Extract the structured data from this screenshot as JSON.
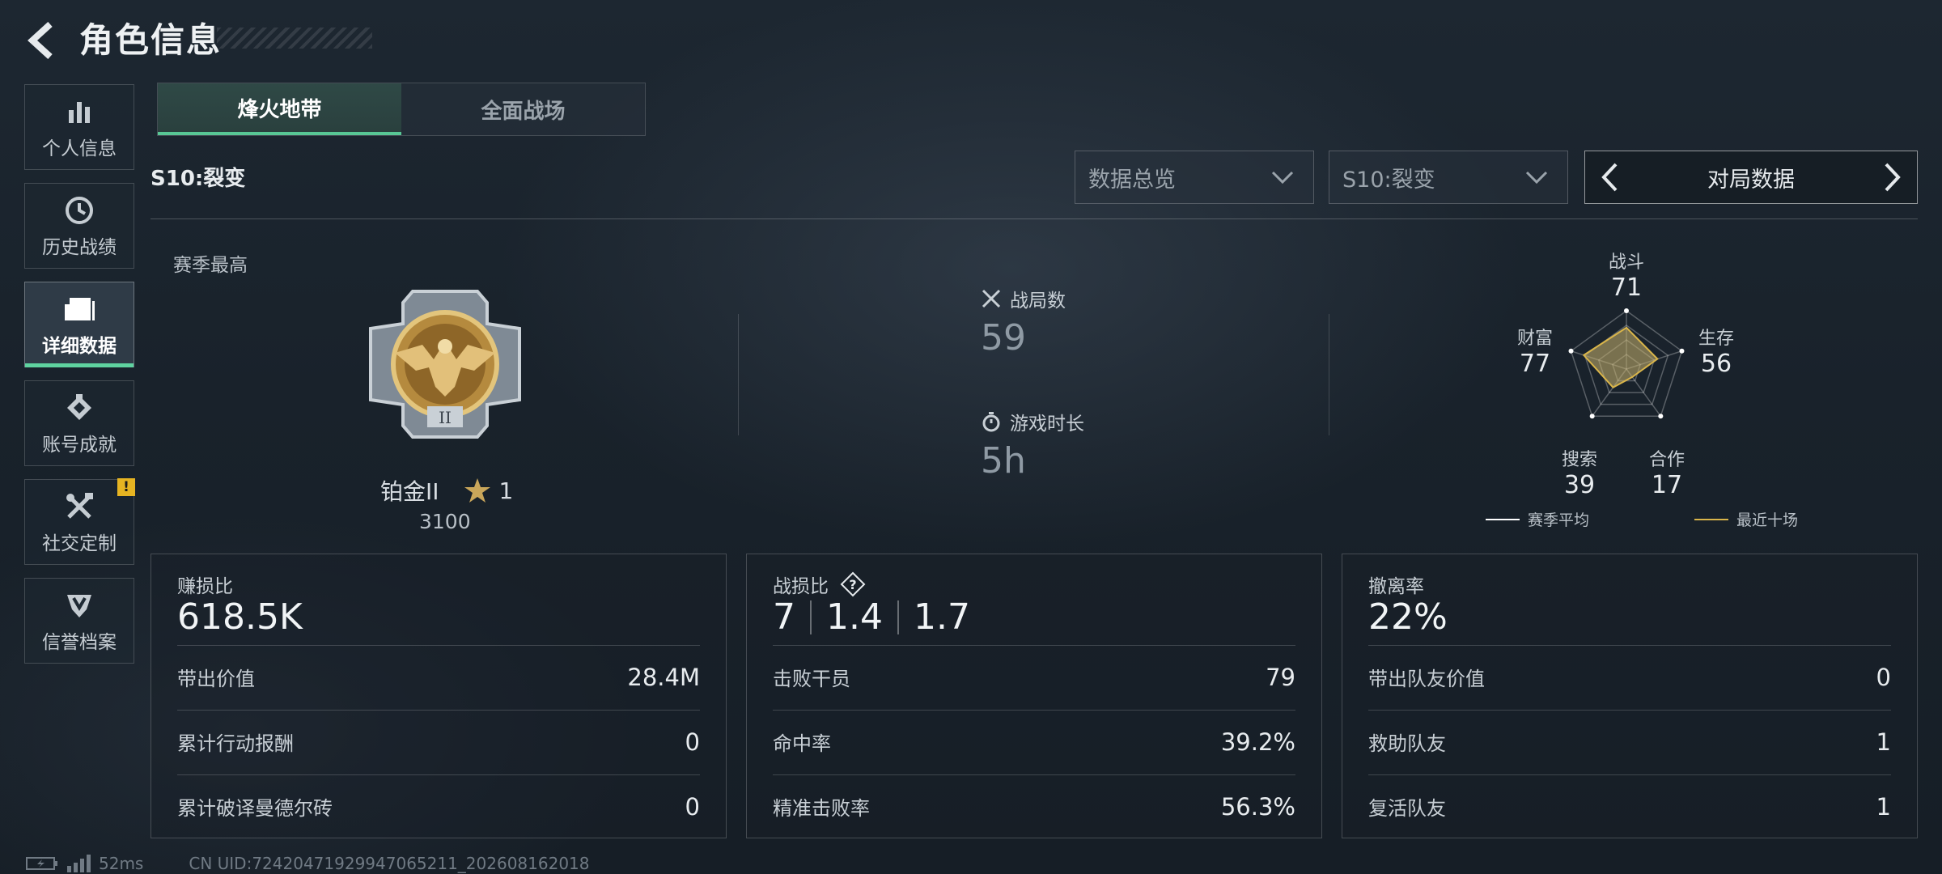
{
  "header": {
    "title": "角色信息"
  },
  "sidebar": {
    "items": [
      {
        "label": "个人信息",
        "icon": "bar-chart-icon"
      },
      {
        "label": "历史战绩",
        "icon": "history-icon"
      },
      {
        "label": "详细数据",
        "icon": "folder-icon",
        "active": true
      },
      {
        "label": "账号成就",
        "icon": "achievement-icon"
      },
      {
        "label": "社交定制",
        "icon": "tools-icon",
        "badge": "!"
      },
      {
        "label": "信誉档案",
        "icon": "shield-icon"
      }
    ]
  },
  "mode_tabs": [
    {
      "label": "烽火地带",
      "active": true
    },
    {
      "label": "全面战场",
      "active": false
    }
  ],
  "season_label": "S10:裂变",
  "filters": {
    "data_type": "数据总览",
    "season": "S10:裂变",
    "pager_label": "对局数据"
  },
  "summary": {
    "best_label": "赛季最高",
    "rank_name": "铂金II",
    "rank_stars": "1",
    "rank_score": "3100",
    "matches_label": "战局数",
    "matches_value": "59",
    "playtime_label": "游戏时长",
    "playtime_value": "5h"
  },
  "radar": {
    "axes": [
      {
        "label": "战斗",
        "value": "71"
      },
      {
        "label": "生存",
        "value": "56"
      },
      {
        "label": "合作",
        "value": "17"
      },
      {
        "label": "搜索",
        "value": "39"
      },
      {
        "label": "财富",
        "value": "77"
      }
    ],
    "legend": [
      {
        "label": "赛季平均",
        "color": "#ffffff"
      },
      {
        "label": "最近十场",
        "color": "#d9b54a"
      }
    ]
  },
  "cards": [
    {
      "title": "赚损比",
      "big": "618.5K",
      "rows": [
        {
          "k": "带出价值",
          "v": "28.4M"
        },
        {
          "k": "累计行动报酬",
          "v": "0"
        },
        {
          "k": "累计破译曼德尔砖",
          "v": "0"
        }
      ]
    },
    {
      "title": "战损比",
      "big_parts": [
        "7",
        "1.4",
        "1.7"
      ],
      "rows": [
        {
          "k": "击败干员",
          "v": "79"
        },
        {
          "k": "命中率",
          "v": "39.2%"
        },
        {
          "k": "精准击败率",
          "v": "56.3%"
        }
      ]
    },
    {
      "title": "撤离率",
      "big": "22%",
      "rows": [
        {
          "k": "带出队友价值",
          "v": "0"
        },
        {
          "k": "救助队友",
          "v": "1"
        },
        {
          "k": "复活队友",
          "v": "1"
        }
      ]
    }
  ],
  "footer": {
    "ping": "52ms",
    "uid": "CN UID:724204719299470​65211_202608162018"
  },
  "colors": {
    "accent": "#58c795",
    "gold": "#d9b54a",
    "badge": "#e6b422"
  }
}
